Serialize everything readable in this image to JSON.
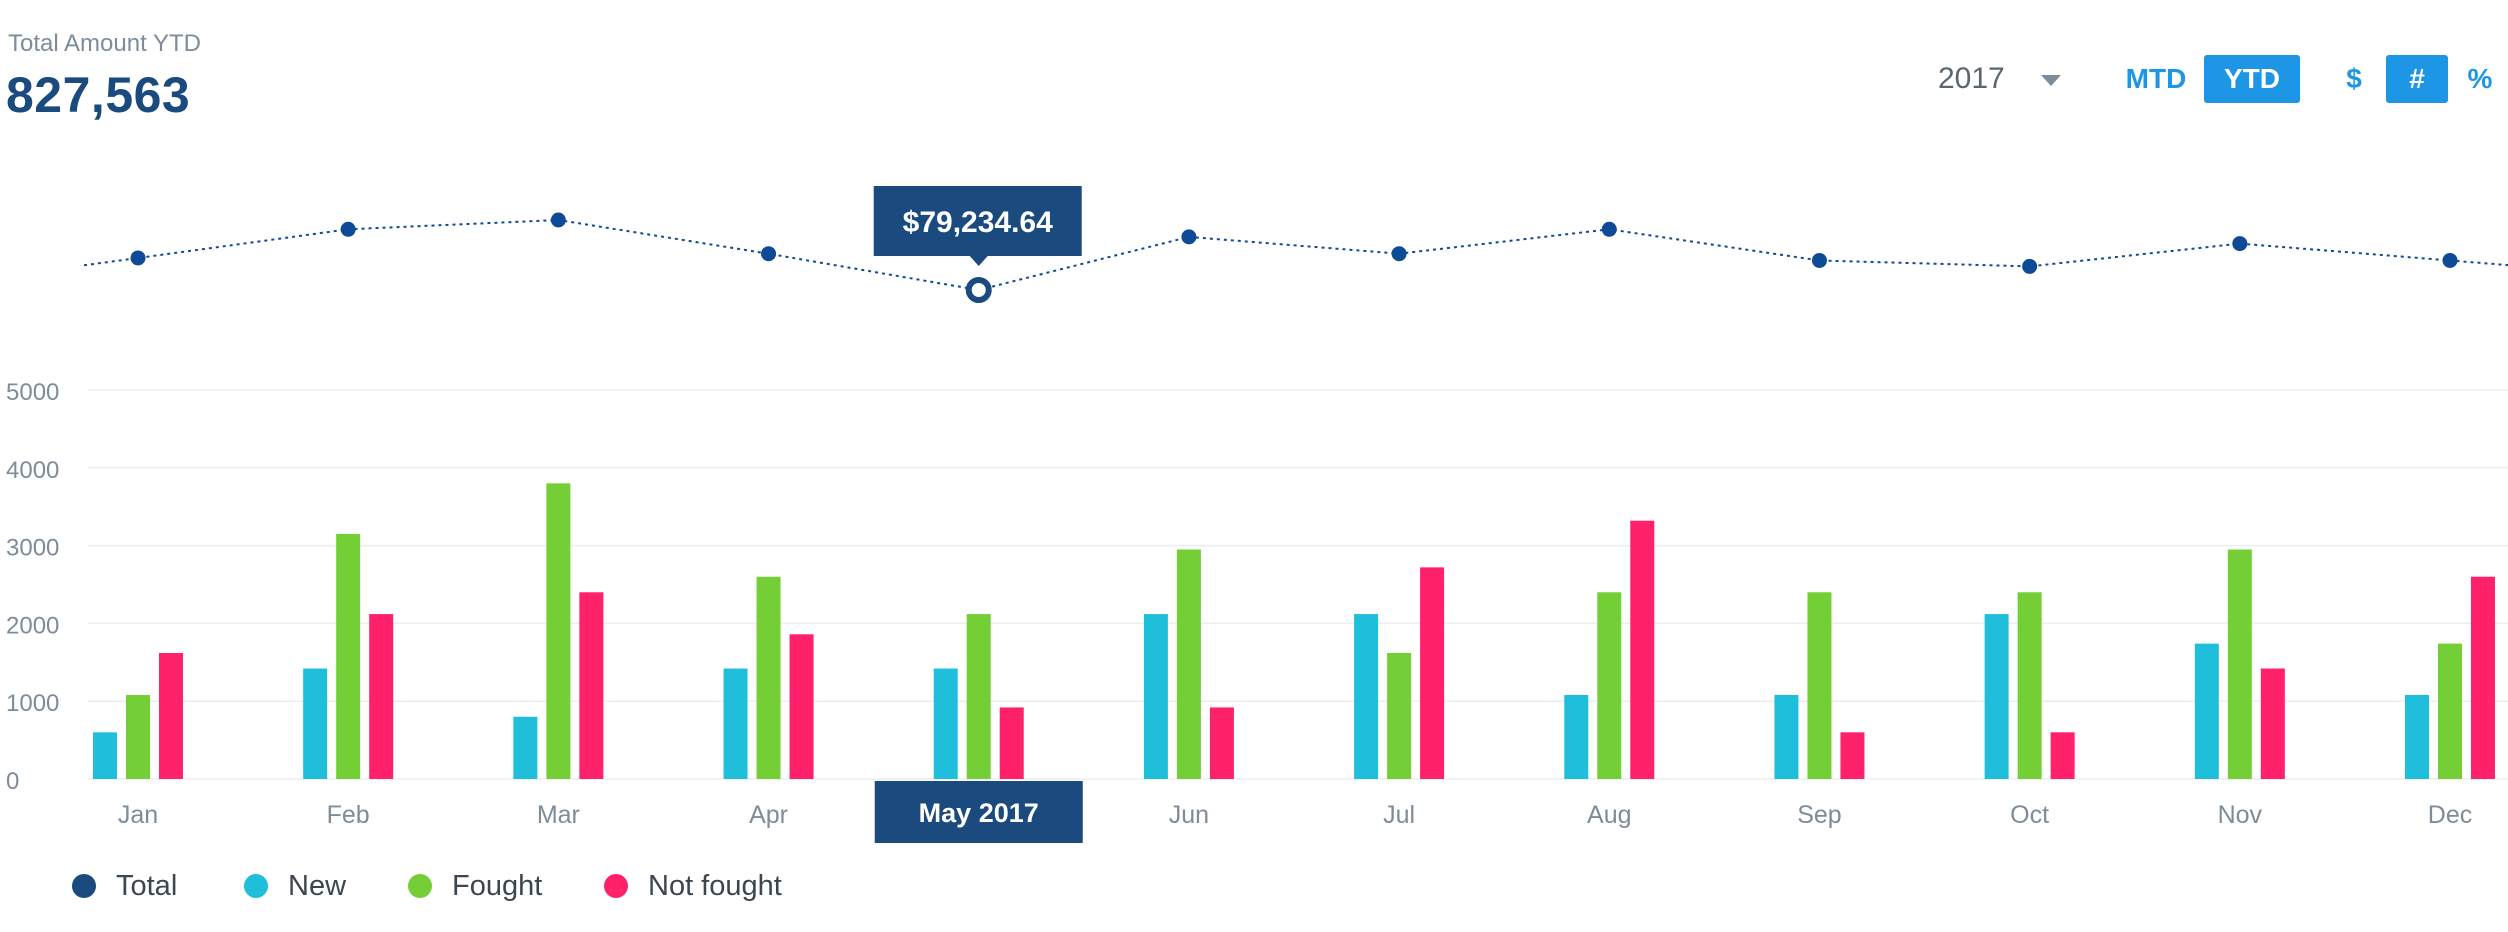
{
  "header": {
    "kpi_label": "Total Amount YTD",
    "kpi_value": "827,563",
    "year": "2017",
    "period_buttons": [
      {
        "label": "MTD",
        "active": false
      },
      {
        "label": "YTD",
        "active": true
      }
    ],
    "unit_buttons": [
      {
        "label": "$",
        "active": false
      },
      {
        "label": "#",
        "active": true
      },
      {
        "label": "%",
        "active": false
      }
    ]
  },
  "colors": {
    "total": "#0f4a96",
    "new": "#1fbfdc",
    "fought": "#74cf36",
    "not_fought": "#ff216a",
    "highlight": "#1a4a7e",
    "accent": "#1e96e6",
    "axis_text": "#7e8c9a"
  },
  "chart_data": {
    "type": "bar",
    "categories": [
      "Jan",
      "Feb",
      "Mar",
      "Apr",
      "May",
      "Jun",
      "Jul",
      "Aug",
      "Sep",
      "Oct",
      "Nov",
      "Dec"
    ],
    "ylim": [
      0,
      5000
    ],
    "yticks": [
      0,
      1000,
      2000,
      3000,
      4000,
      5000
    ],
    "grid": true,
    "selected_category": "May",
    "selected_label": "May 2017",
    "series": [
      {
        "name": "New",
        "values": [
          600,
          1420,
          800,
          1420,
          1420,
          2120,
          2120,
          1080,
          1080,
          2120,
          1740,
          1080
        ]
      },
      {
        "name": "Fought",
        "values": [
          1080,
          3150,
          3800,
          2600,
          2120,
          2950,
          1620,
          2400,
          2400,
          2400,
          2950,
          1740
        ]
      },
      {
        "name": "Not fought",
        "values": [
          1620,
          2120,
          2400,
          1860,
          920,
          920,
          2720,
          3320,
          600,
          600,
          1420,
          2600
        ]
      }
    ],
    "total_line": {
      "name": "Total",
      "values": [
        71200,
        74600,
        75700,
        71700,
        67400,
        73700,
        71700,
        74600,
        70900,
        70200,
        72900,
        70900
      ],
      "tooltip": "$79,234.64",
      "legend_position": "bottom-left"
    }
  },
  "legend": [
    {
      "label": "Total",
      "key": "total"
    },
    {
      "label": "New",
      "key": "new"
    },
    {
      "label": "Fought",
      "key": "fought"
    },
    {
      "label": "Not fought",
      "key": "not_fought"
    }
  ]
}
